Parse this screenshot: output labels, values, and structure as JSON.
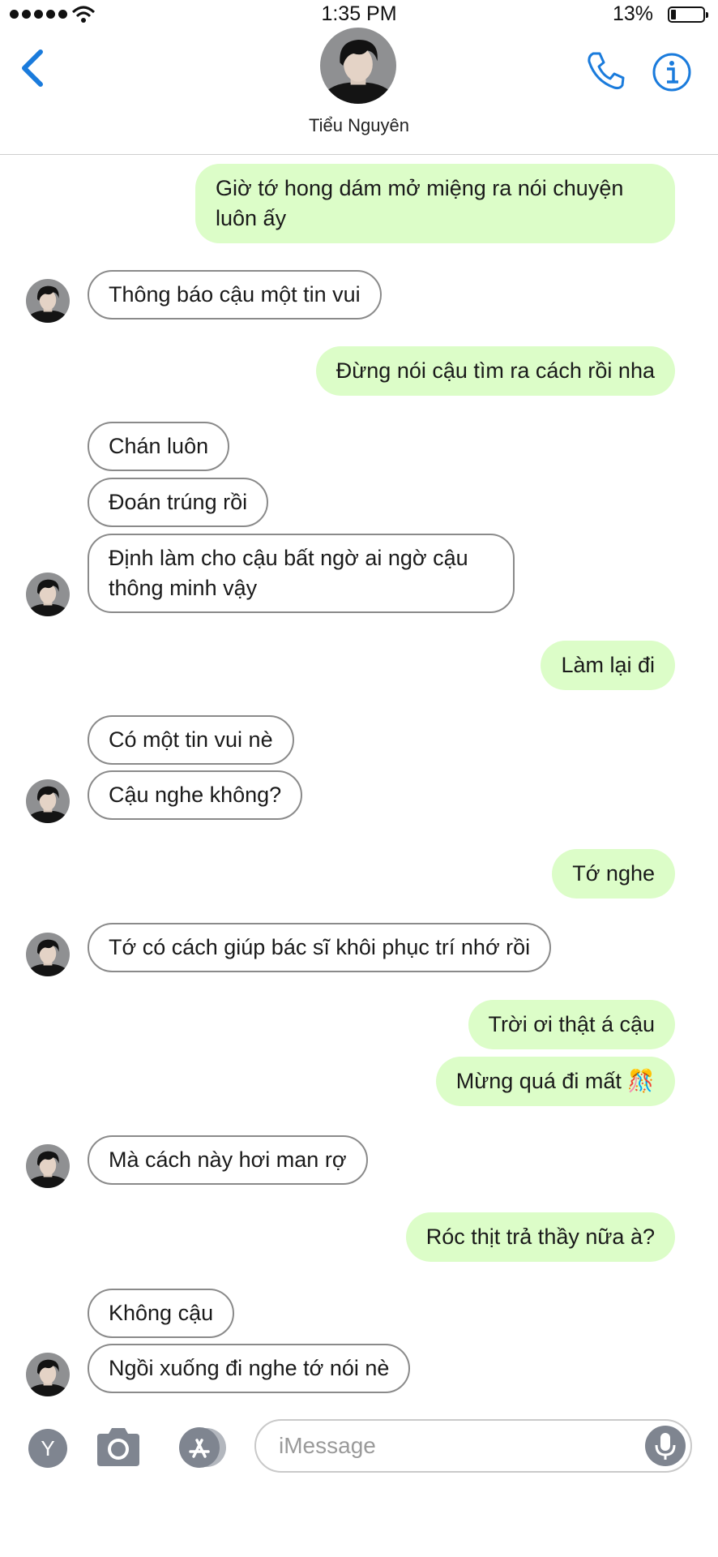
{
  "status": {
    "time": "1:35 PM",
    "battery": "13%"
  },
  "contact": {
    "name": "Tiểu Nguyên"
  },
  "messages": [
    {
      "side": "sent",
      "text": "Giờ tớ hong dám mở miệng ra nói chuyện luôn ấy"
    },
    {
      "side": "recv",
      "text": "Thông báo cậu một tin vui"
    },
    {
      "side": "sent",
      "text": "Đừng nói cậu tìm ra cách rồi nha"
    },
    {
      "side": "recv",
      "text": "Chán luôn"
    },
    {
      "side": "recv",
      "text": "Đoán trúng rồi"
    },
    {
      "side": "recv",
      "text": "Định làm cho cậu bất ngờ ai ngờ cậu thông minh vậy"
    },
    {
      "side": "sent",
      "text": "Làm lại đi"
    },
    {
      "side": "recv",
      "text": "Có một tin vui nè"
    },
    {
      "side": "recv",
      "text": "Cậu nghe không?"
    },
    {
      "side": "sent",
      "text": "Tớ nghe"
    },
    {
      "side": "recv",
      "text": "Tớ có cách giúp bác sĩ khôi phục trí nhớ rồi"
    },
    {
      "side": "sent",
      "text": "Trời ơi thật á cậu"
    },
    {
      "side": "sent",
      "text": "Mừng quá đi mất 🎊"
    },
    {
      "side": "recv",
      "text": "Mà cách này hơi man rợ"
    },
    {
      "side": "sent",
      "text": "Róc thịt trả thầy nữa à?"
    },
    {
      "side": "recv",
      "text": "Không cậu"
    },
    {
      "side": "recv",
      "text": "Ngồi xuống đi nghe tớ nói nè"
    }
  ],
  "composer": {
    "app_button": "Y",
    "placeholder": "iMessage"
  },
  "icons": {
    "back": "chevron-left-icon",
    "phone": "phone-icon",
    "info": "info-icon",
    "camera": "camera-icon",
    "appstore": "app-store-icon",
    "mic": "microphone-icon"
  },
  "colors": {
    "accent": "#1a7bdc",
    "sent_bubble": "#dcfdc8",
    "recv_border": "#8a8a8a"
  }
}
